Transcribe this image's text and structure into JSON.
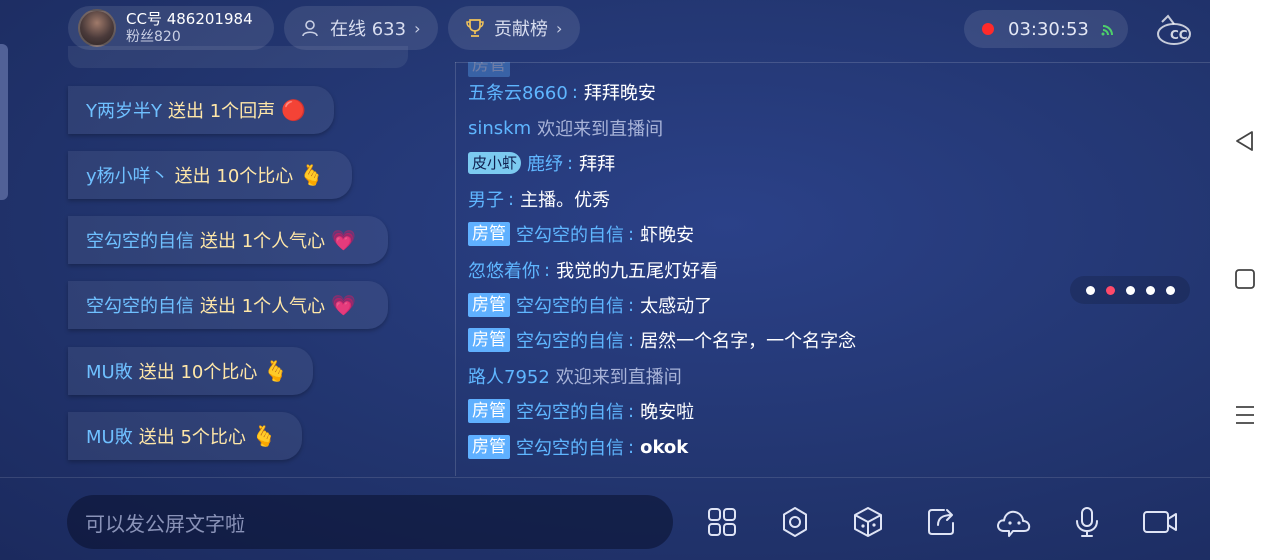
{
  "header": {
    "profile": {
      "id_text": "CC号 486201984",
      "fans_text": "粉丝820"
    },
    "online": {
      "label": "在线 633"
    },
    "rank": {
      "label": "贡献榜"
    },
    "chevron": "›",
    "timer": "03:30:53",
    "logo_text": "CC直播"
  },
  "gifts": [
    {
      "user": "Y两岁半Y",
      "action": "送出 1个回声",
      "icon": "red-circle-echo-icon",
      "glyph": "🔴"
    },
    {
      "user": "y杨小咩丶",
      "action": "送出 10个比心",
      "icon": "heart-hands-icon",
      "glyph": "🫰"
    },
    {
      "user": "空勾空的自信",
      "action": "送出 1个人气心",
      "icon": "pink-heart-icon",
      "glyph": "💗"
    },
    {
      "user": "空勾空的自信",
      "action": "送出 1个人气心",
      "icon": "pink-heart-icon",
      "glyph": "💗"
    },
    {
      "user": "MU敗",
      "action": "送出 10个比心",
      "icon": "heart-hands-icon",
      "glyph": "🫰"
    },
    {
      "user": "MU敗",
      "action": "送出 5个比心",
      "icon": "heart-hands-icon",
      "glyph": "🫰"
    }
  ],
  "chat": {
    "admin_badge": "房管",
    "messages": [
      {
        "name": "五条云8660",
        "sep": ":",
        "text": "拜拜晚安"
      },
      {
        "name": "sinskm",
        "system": "欢迎来到直播间"
      },
      {
        "badge": "皮小虾",
        "name": "鹿纾",
        "sep": ":",
        "text": "拜拜"
      },
      {
        "name": "男子",
        "sep": ":",
        "text": "主播。优秀"
      },
      {
        "admin": true,
        "name": "空勾空的自信",
        "sep": ":",
        "text": "虾晚安"
      },
      {
        "name": "忽悠着你",
        "sep": ":",
        "text": "我觉的九五尾灯好看"
      },
      {
        "admin": true,
        "name": "空勾空的自信",
        "sep": ":",
        "text": "太感动了"
      },
      {
        "admin": true,
        "name": "空勾空的自信",
        "sep": ":",
        "text": "居然一个名字，一个名字念"
      },
      {
        "name": "路人7952",
        "system": "欢迎来到直播间"
      },
      {
        "admin": true,
        "name": "空勾空的自信",
        "sep": ":",
        "text": "晚安啦"
      },
      {
        "admin": true,
        "name": "空勾空的自信",
        "sep": ":",
        "text": "okok"
      }
    ]
  },
  "pager": {
    "count": 5,
    "active_index": 1,
    "active_color": "#ff4a6a"
  },
  "input": {
    "placeholder": "可以发公屏文字啦"
  },
  "toolbar": [
    "apps-grid-icon",
    "settings-gear-icon",
    "game-cube-icon",
    "share-icon",
    "cloud-face-icon",
    "microphone-icon",
    "video-camera-icon"
  ],
  "colors": {
    "username": "#5fb6ff",
    "gift_text": "#ffe7a8",
    "badge_bg": "#5fb0ff",
    "record": "#ff2a2a"
  }
}
